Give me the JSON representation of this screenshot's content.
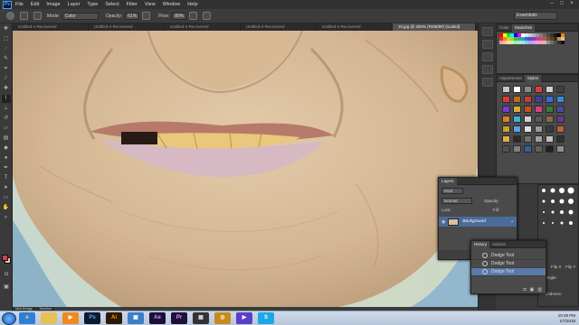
{
  "app": {
    "logo": "Ps"
  },
  "menu": [
    "File",
    "Edit",
    "Image",
    "Layer",
    "Type",
    "Select",
    "Filter",
    "View",
    "Window",
    "Help"
  ],
  "options": {
    "mode_label": "Mode:",
    "mode_value": "Color",
    "opacity_label": "Opacity:",
    "opacity_value": "61%",
    "flow_label": "Flow:",
    "flow_value": "80%",
    "workspace": "Essentials"
  },
  "tabs": [
    {
      "label": "Untitled-1-Recovered",
      "active": false
    },
    {
      "label": "Untitled-2-Recovered",
      "active": false
    },
    {
      "label": "Untitled-2-Recovered",
      "active": false
    },
    {
      "label": "Untitled-2-Recovered",
      "active": false
    },
    {
      "label": "Untitled-2-Recovered",
      "active": false
    },
    {
      "label": "10.jpg @ 400% (RGB/8#) (scaled)",
      "active": true
    }
  ],
  "panels": {
    "color_tabs": [
      "Color",
      "Swatches"
    ],
    "adj_tabs": [
      "Adjustments",
      "Styles"
    ]
  },
  "brush": {
    "angle_label": "Angle:",
    "roundness_label": "Roundness:",
    "flip_x": "Flip X",
    "flip_y": "Flip Y"
  },
  "layers": {
    "title": "Layers",
    "kind": "Kind",
    "blend": "Normal",
    "opacity_label": "Opacity:",
    "lock_label": "Lock:",
    "fill_label": "Fill:",
    "layer_name": "Background"
  },
  "history": {
    "tabs": [
      "History",
      "Actions"
    ],
    "items": [
      "Dodge Tool",
      "Dodge Tool",
      "Dodge Tool"
    ]
  },
  "mini_panels": [
    "Mini Bridge",
    "Timeline"
  ],
  "taskbar": {
    "apps": [
      {
        "name": "ie-icon",
        "label": "e",
        "bg": "#2f7fd6",
        "fg": "#ffd24a"
      },
      {
        "name": "folder-icon",
        "label": "",
        "bg": "#e8c05a",
        "fg": "#000"
      },
      {
        "name": "media-player-icon",
        "label": "▶",
        "bg": "#f08a1c",
        "fg": "#fff"
      },
      {
        "name": "photoshop-icon",
        "label": "Ps",
        "bg": "#0d1a2e",
        "fg": "#4aa3ff"
      },
      {
        "name": "illustrator-icon",
        "label": "Ai",
        "bg": "#2b1a07",
        "fg": "#ff9a00"
      },
      {
        "name": "network-icon",
        "label": "▣",
        "bg": "#3c7fc6",
        "fg": "#fff"
      },
      {
        "name": "after-effects-icon",
        "label": "Ae",
        "bg": "#1c0f3a",
        "fg": "#c49bff"
      },
      {
        "name": "premiere-icon",
        "label": "Pr",
        "bg": "#1c0f3a",
        "fg": "#e49bff"
      },
      {
        "name": "video-icon",
        "label": "▦",
        "bg": "#333",
        "fg": "#ddd"
      },
      {
        "name": "headphones-icon",
        "label": "◎",
        "bg": "#c98a1c",
        "fg": "#fff"
      },
      {
        "name": "play-icon",
        "label": "▶",
        "bg": "#5a3fc8",
        "fg": "#fff"
      },
      {
        "name": "skype-icon",
        "label": "S",
        "bg": "#19a9e5",
        "fg": "#fff"
      }
    ],
    "time": "10:49 PM",
    "date": "1/7/2018"
  }
}
